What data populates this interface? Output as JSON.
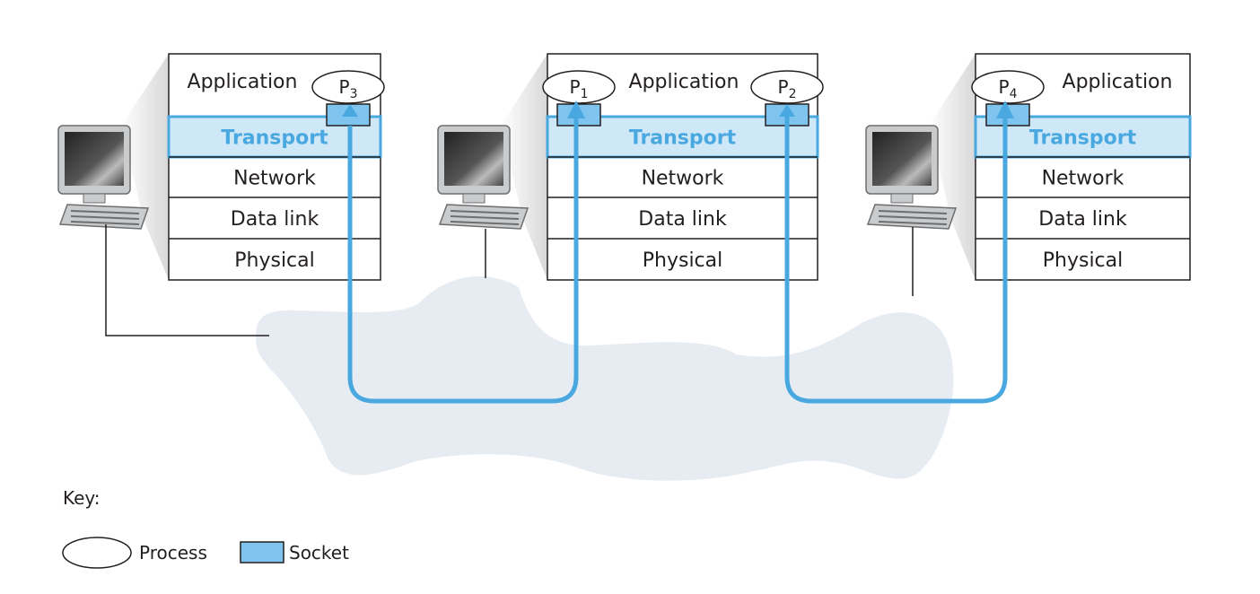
{
  "hosts": [
    {
      "layers": [
        "Application",
        "Transport",
        "Network",
        "Data link",
        "Physical"
      ],
      "processes": [
        {
          "name": "P",
          "sub": "3"
        }
      ]
    },
    {
      "layers": [
        "Application",
        "Transport",
        "Network",
        "Data link",
        "Physical"
      ],
      "processes": [
        {
          "name": "P",
          "sub": "1"
        },
        {
          "name": "P",
          "sub": "2"
        }
      ]
    },
    {
      "layers": [
        "Application",
        "Transport",
        "Network",
        "Data link",
        "Physical"
      ],
      "processes": [
        {
          "name": "P",
          "sub": "4"
        }
      ]
    }
  ],
  "key": {
    "title": "Key:",
    "process_label": "Process",
    "socket_label": "Socket"
  },
  "colors": {
    "transport_fill": "#cfe8f8",
    "transport_stroke": "#4aa8e0",
    "socket_fill": "#7fc4ee",
    "connection": "#4aa8e0",
    "network_cloud": "#e6ecf2"
  }
}
